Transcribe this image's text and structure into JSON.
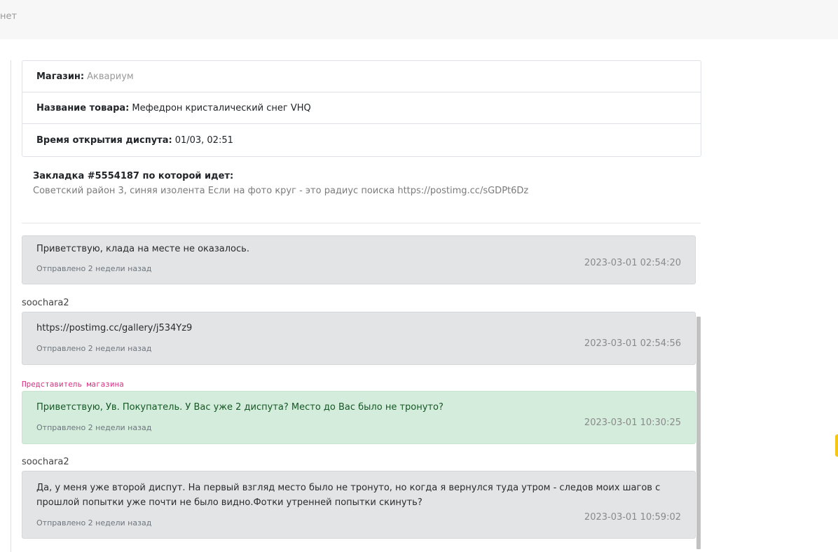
{
  "topbar": {
    "text": "нет"
  },
  "info": {
    "shop_label": "Магазин:",
    "shop_value": "Аквариум",
    "product_label": "Название товара:",
    "product_value": "Мефедрон кристалический снег VHQ",
    "opened_label": "Время открытия диспута:",
    "opened_value": "01/03, 02:51"
  },
  "bookmark": {
    "title": "Закладка #5554187 по которой идет:",
    "text": "Советский район 3, синяя изолента Если на фото круг - это радиус поиска https://postimg.cc/sGDPt6Dz"
  },
  "messages": [
    {
      "author": "",
      "text": "Приветствую, клада на месте не оказалось.",
      "sent": "Отправлено 2 недели назад",
      "time": "2023-03-01 02:54:20"
    },
    {
      "author": "soochara2",
      "text": "https://postimg.cc/gallery/j534Yz9",
      "sent": "Отправлено 2 недели назад",
      "time": "2023-03-01 02:54:56"
    },
    {
      "author": "Представитель магазина",
      "text": "Приветствую, Ув. Покупатель. У Вас уже 2 диспута? Место до Вас было не тронуто?",
      "sent": "Отправлено 2 недели назад",
      "time": "2023-03-01 10:30:25"
    },
    {
      "author": "soochara2",
      "text": "Да, у меня уже второй диспут. На первый взгляд место было не тронуто, но когда я вернулся туда утром - следов моих шагов с прошлой попытки уже почти не было видно.Фотки утренней попытки скинуть?",
      "sent": "Отправлено 2 недели назад",
      "time": "2023-03-01 10:59:02"
    }
  ],
  "colors": {
    "message_bg": "#e3e4e6",
    "shop_message_bg": "#d4ecdb",
    "shop_author": "#d63384",
    "side_tab": "#f5c518"
  }
}
